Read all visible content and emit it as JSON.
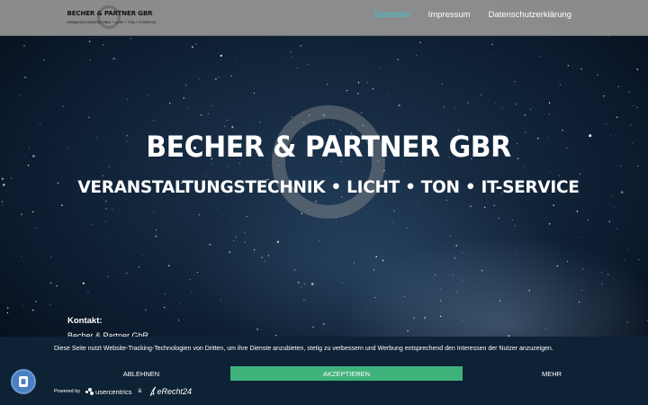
{
  "header": {
    "logo": {
      "title": "BECHER & PARTNER GBR",
      "subtitle": "VERANSTALTUNGSTECHNIK • LICHT • TON • IT-SERVICE"
    },
    "nav": [
      {
        "label": "Startseite",
        "active": true
      },
      {
        "label": "Impressum",
        "active": false
      },
      {
        "label": "Datenschutzerklärung",
        "active": false
      }
    ]
  },
  "hero": {
    "title": "BECHER & PARTNER GBR",
    "subtitle": "VERANSTALTUNGSTECHNIK • LICHT • TON • IT-SERVICE"
  },
  "contact": {
    "heading": "Kontakt:",
    "company": "Becher & Partner GbR"
  },
  "consent": {
    "text": "Diese Seite nutzt Website-Tracking-Technologien von Dritten, um ihre Dienste anzubieten, stetig zu verbessern und Werbung entsprechend den Interessen der Nutzer anzuzeigen.",
    "decline_label": "ABLEHNEN",
    "accept_label": "AKZEPTIEREN",
    "more_label": "MEHR",
    "powered_by": "Powered by",
    "provider1": "usercentrics",
    "ampersand": "&",
    "provider2": "eRecht24"
  },
  "colors": {
    "accent_nav": "#3ec4c8",
    "accept_button": "#3fb27c",
    "consent_bg": "#0e2235",
    "header_bg": "#969696"
  },
  "icons": {
    "privacy_button": "fingerprint-shield-icon",
    "usercentrics": "usercentrics-logo-icon",
    "erecht": "erecht24-signature-icon"
  }
}
